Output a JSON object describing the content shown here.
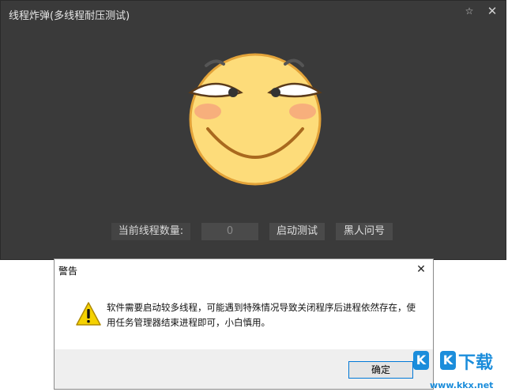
{
  "app": {
    "title": "线程炸弹(多线程耐压测试)",
    "pin_glyph": "☆",
    "close_glyph": "✕",
    "thread_count_label": "当前线程数量:",
    "thread_count_value": "0",
    "start_button_label": "启动测试",
    "dark_button_label": "黑人问号",
    "emoji_icon": "smirk-emoji-icon"
  },
  "dialog": {
    "title": "警告",
    "close_glyph": "✕",
    "message": "软件需要启动较多线程，可能遇到特殊情况导致关闭程序后进程依然存在，使用任务管理器结束进程即可，小白慎用。",
    "ok_label": "确定",
    "warning_icon": "warning-triangle-icon"
  },
  "watermark": {
    "letter1": "K",
    "letter2": "K",
    "hanzi": "下载",
    "url": "www.kkx.net"
  },
  "colors": {
    "app_background": "#3a3a3a",
    "emoji_face": "#fddc7a",
    "emoji_outline": "#e3a339",
    "blush": "#f6a77c",
    "warning_yellow": "#f5d200",
    "accent_blue": "#0078d7",
    "watermark_blue": "#1b8ddb"
  }
}
